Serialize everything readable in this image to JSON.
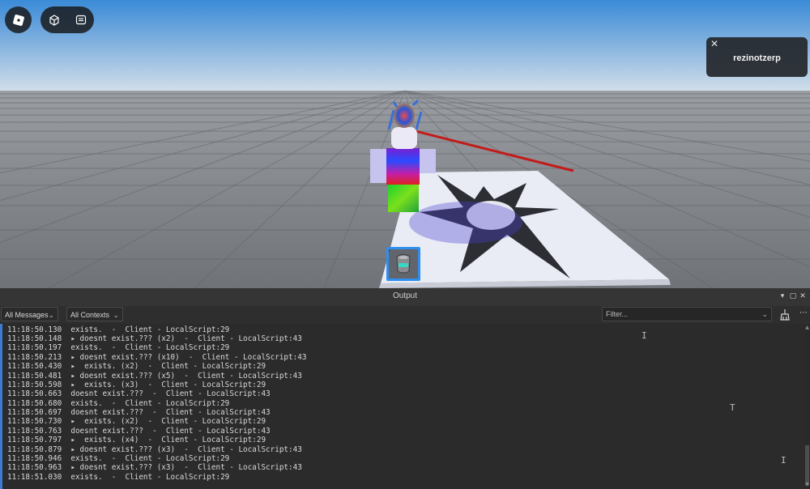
{
  "hud": {
    "roblox_menu_icon": "roblox-logo-icon",
    "selfview_icon": "selfview-cube-icon",
    "chat_icon": "chat-icon"
  },
  "notification": {
    "close_glyph": "✕",
    "username": "rezinotzerp"
  },
  "output": {
    "title": "Output",
    "message_filter": "All Messages",
    "context_filter": "All Contexts",
    "filter_placeholder": "Filter...",
    "lines": [
      "11:18:50.130  exists.  -  Client - LocalScript:29",
      "11:18:50.148  ▸ doesnt exist.??? (x2)  -  Client - LocalScript:43",
      "11:18:50.197  exists.  -  Client - LocalScript:29",
      "11:18:50.213  ▸ doesnt exist.??? (x10)  -  Client - LocalScript:43",
      "11:18:50.430  ▸  exists. (x2)  -  Client - LocalScript:29",
      "11:18:50.481  ▸ doesnt exist.??? (x5)  -  Client - LocalScript:43",
      "11:18:50.598  ▸  exists. (x3)  -  Client - LocalScript:29",
      "11:18:50.663  doesnt exist.???  -  Client - LocalScript:43",
      "11:18:50.680  exists.  -  Client - LocalScript:29",
      "11:18:50.697  doesnt exist.???  -  Client - LocalScript:43",
      "11:18:50.730  ▸  exists. (x2)  -  Client - LocalScript:29",
      "11:18:50.763  doesnt exist.???  -  Client - LocalScript:43",
      "11:18:50.797  ▸  exists. (x4)  -  Client - LocalScript:29",
      "11:18:50.879  ▸ doesnt exist.??? (x3)  -  Client - LocalScript:43",
      "11:18:50.946  exists.  -  Client - LocalScript:29",
      "11:18:50.963  ▸ doesnt exist.??? (x3)  -  Client - LocalScript:43",
      "11:18:51.030  exists.  -  Client - LocalScript:29"
    ]
  },
  "colors": {
    "sky_top": "#3d8fd9",
    "sky_bottom": "#c9d9e8",
    "floor": "#7f8287",
    "selection_blue": "#2f8ff0",
    "output_bg": "#2b2b2b",
    "log_text": "#d9d9d9"
  }
}
